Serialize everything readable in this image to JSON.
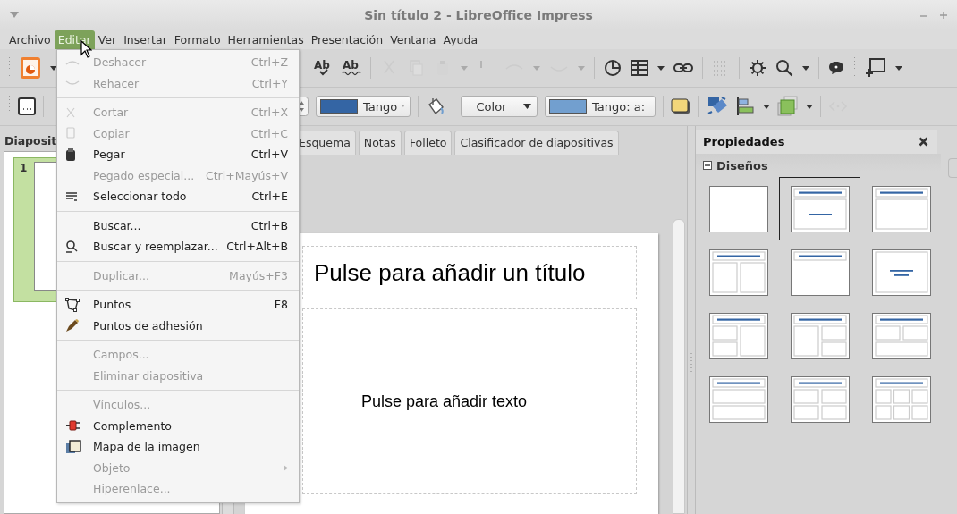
{
  "window": {
    "title": "Sin título 2 - LibreOffice Impress"
  },
  "menubar": [
    {
      "label": "Archivo",
      "selected": false
    },
    {
      "label": "Editar",
      "selected": true
    },
    {
      "label": "Ver",
      "selected": false
    },
    {
      "label": "Insertar",
      "selected": false
    },
    {
      "label": "Formato",
      "selected": false
    },
    {
      "label": "Herramientas",
      "selected": false
    },
    {
      "label": "Presentación",
      "selected": false
    },
    {
      "label": "Ventana",
      "selected": false
    },
    {
      "label": "Ayuda",
      "selected": false
    }
  ],
  "edit_menu": {
    "groups": [
      [
        {
          "label": "Deshacer",
          "shortcut": "Ctrl+Z",
          "disabled": true,
          "submenu": false
        },
        {
          "label": "Rehacer",
          "shortcut": "Ctrl+Y",
          "disabled": true,
          "submenu": false
        }
      ],
      [
        {
          "label": "Cortar",
          "shortcut": "Ctrl+X",
          "disabled": true,
          "submenu": false
        },
        {
          "label": "Copiar",
          "shortcut": "Ctrl+C",
          "disabled": true,
          "submenu": false
        },
        {
          "label": "Pegar",
          "shortcut": "Ctrl+V",
          "disabled": false,
          "submenu": false
        },
        {
          "label": "Pegado especial...",
          "shortcut": "Ctrl+Mayús+V",
          "disabled": true,
          "submenu": false
        },
        {
          "label": "Seleccionar todo",
          "shortcut": "Ctrl+E",
          "disabled": false,
          "submenu": false
        }
      ],
      [
        {
          "label": "Buscar...",
          "shortcut": "Ctrl+B",
          "disabled": false,
          "submenu": false
        },
        {
          "label": "Buscar y reemplazar...",
          "shortcut": "Ctrl+Alt+B",
          "disabled": false,
          "submenu": false
        }
      ],
      [
        {
          "label": "Duplicar...",
          "shortcut": "Mayús+F3",
          "disabled": true,
          "submenu": false
        }
      ],
      [
        {
          "label": "Puntos",
          "shortcut": "F8",
          "disabled": false,
          "submenu": false
        },
        {
          "label": "Puntos de adhesión",
          "disabled": false,
          "submenu": false
        }
      ],
      [
        {
          "label": "Campos...",
          "disabled": true,
          "submenu": false
        },
        {
          "label": "Eliminar diapositiva",
          "disabled": true,
          "submenu": false
        }
      ],
      [
        {
          "label": "Vínculos...",
          "disabled": true,
          "submenu": false
        },
        {
          "label": "Complemento",
          "disabled": false,
          "submenu": false
        },
        {
          "label": "Mapa de la imagen",
          "disabled": false,
          "submenu": false
        },
        {
          "label": "Objeto",
          "disabled": true,
          "submenu": true
        },
        {
          "label": "Hiperenlace...",
          "disabled": true,
          "submenu": false
        }
      ]
    ]
  },
  "standard_toolbar": {
    "spellcheck_label": "Ab",
    "auto_spellcheck_label": "Ab"
  },
  "formatting_toolbar": {
    "line_color": {
      "label": "Tango",
      "color": "#3465a4"
    },
    "area_style": {
      "value": "Color"
    },
    "area_color": {
      "label": "Tango: a:",
      "color": "#729fcf"
    }
  },
  "view_tabs": [
    {
      "label": "Esquema",
      "selected": false
    },
    {
      "label": "Notas",
      "selected": false
    },
    {
      "label": "Folleto",
      "selected": false
    },
    {
      "label": "Clasificador de diapositivas",
      "selected": false
    }
  ],
  "slides_pane": {
    "title": "Diaposit",
    "slides": [
      {
        "number": "1",
        "selected": true
      }
    ]
  },
  "slide": {
    "title_placeholder": "Pulse para añadir un título",
    "body_placeholder": "Pulse para añadir texto"
  },
  "sidebar": {
    "title": "Propiedades",
    "section": {
      "title": "Diseños",
      "expanded": true
    },
    "layouts": [
      {
        "kind": "blank",
        "selected": false
      },
      {
        "kind": "title-content",
        "selected": true
      },
      {
        "kind": "title-body",
        "selected": false
      },
      {
        "kind": "title-2col",
        "selected": false
      },
      {
        "kind": "title-only",
        "selected": false
      },
      {
        "kind": "centered-text",
        "selected": false
      },
      {
        "kind": "title-2left-1right",
        "selected": false
      },
      {
        "kind": "title-1left-2right",
        "selected": false
      },
      {
        "kind": "title-2top-1bottom",
        "selected": false
      },
      {
        "kind": "title-2rows",
        "selected": false
      },
      {
        "kind": "title-2x2",
        "selected": false
      },
      {
        "kind": "title-3x2",
        "selected": false
      }
    ]
  }
}
